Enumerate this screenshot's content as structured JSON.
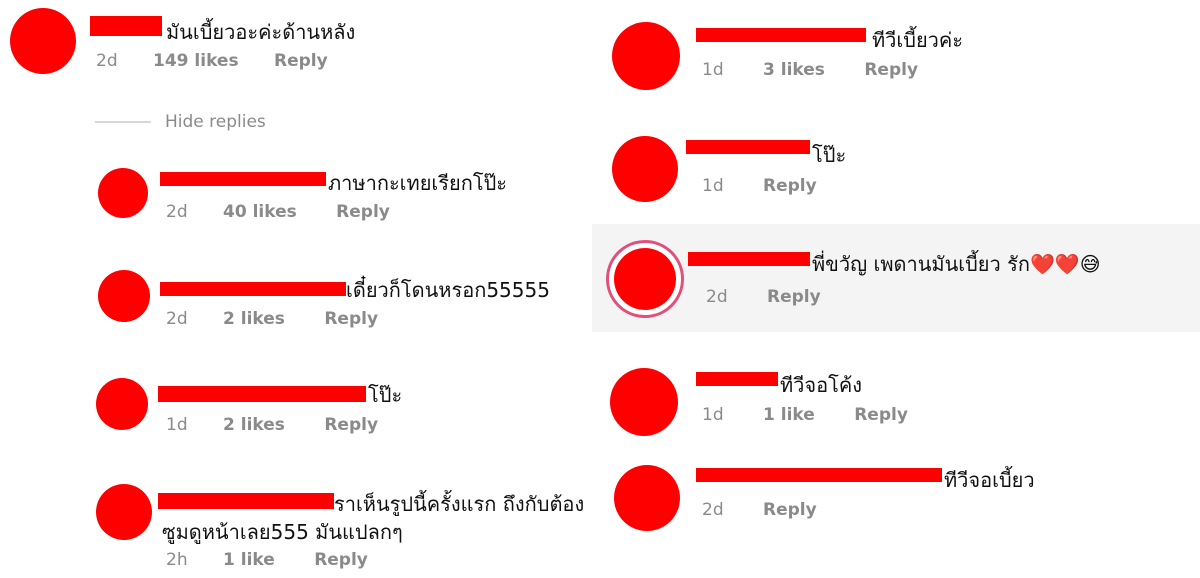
{
  "left": {
    "main": {
      "text": "มันเบี้ยวอะค่ะด้านหลัง",
      "age": "2d",
      "likes": "149 likes",
      "reply": "Reply"
    },
    "hide_replies": "Hide replies",
    "replies": [
      {
        "text": "ภาษากะเทยเรียกโป๊ะ",
        "age": "2d",
        "likes": "40 likes",
        "reply": "Reply"
      },
      {
        "text": "เดี๋ยวก็โดนหรอก55555",
        "age": "2d",
        "likes": "2 likes",
        "reply": "Reply"
      },
      {
        "text": "โป๊ะ",
        "age": "1d",
        "likes": "2 likes",
        "reply": "Reply"
      },
      {
        "text_line1": "ราเห็นรูปนี้ครั้งแรก ถึงกับต้อง",
        "text_line2": "ซูมดูหน้าเลย555 มันแปลกๆ",
        "age": "2h",
        "likes": "1 like",
        "reply": "Reply"
      }
    ]
  },
  "right": {
    "comments": [
      {
        "text": "ทีวีเบี้ยวค่ะ",
        "age": "1d",
        "likes": "3 likes",
        "reply": "Reply"
      },
      {
        "text": "โป๊ะ",
        "age": "1d",
        "reply": "Reply"
      },
      {
        "text": "พี่ขวัญ เพดานมันเบี้ยว รัก",
        "emoji": "❤️❤️😅",
        "age": "2d",
        "reply": "Reply"
      },
      {
        "text": "ทีวีจอโค้ง",
        "age": "1d",
        "likes": "1 like",
        "reply": "Reply"
      },
      {
        "text": "ทีวีจอเบี้ยว",
        "age": "2d",
        "reply": "Reply"
      }
    ]
  },
  "colors": {
    "redaction": "#ff0000",
    "meta": "#8a8a8a",
    "story_ring": "#e0507a"
  }
}
